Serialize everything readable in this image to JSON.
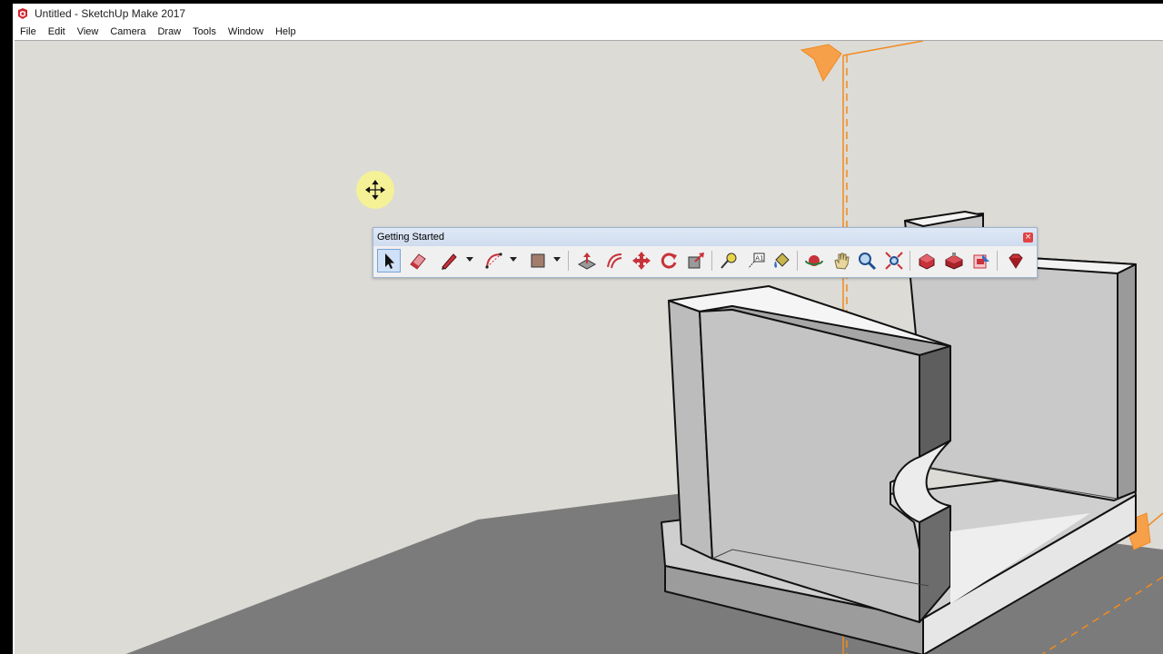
{
  "window": {
    "title": "Untitled - SketchUp Make 2017"
  },
  "menu": [
    "File",
    "Edit",
    "View",
    "Camera",
    "Draw",
    "Tools",
    "Window",
    "Help"
  ],
  "toolbar": {
    "title": "Getting Started",
    "close_glyph": "×",
    "tools": [
      {
        "name": "select-tool-button",
        "icon": "arrow-cursor-icon"
      },
      {
        "name": "eraser-tool-button",
        "icon": "eraser-icon"
      },
      {
        "name": "line-tool-button",
        "icon": "pencil-icon",
        "dropdown": true
      },
      {
        "name": "arc-tool-button",
        "icon": "arc-icon",
        "dropdown": true
      },
      {
        "name": "rectangle-tool-button",
        "icon": "rectangle-icon",
        "dropdown": true
      },
      {
        "name": "push-pull-tool-button",
        "icon": "push-pull-icon"
      },
      {
        "name": "offset-tool-button",
        "icon": "offset-icon"
      },
      {
        "name": "move-tool-button",
        "icon": "move-icon"
      },
      {
        "name": "rotate-tool-button",
        "icon": "rotate-icon"
      },
      {
        "name": "scale-tool-button",
        "icon": "scale-icon"
      },
      {
        "name": "tape-measure-tool-button",
        "icon": "tape-measure-icon"
      },
      {
        "name": "text-tool-button",
        "icon": "text-a1-icon"
      },
      {
        "name": "paint-bucket-tool-button",
        "icon": "paint-bucket-icon"
      },
      {
        "name": "orbit-tool-button",
        "icon": "orbit-icon"
      },
      {
        "name": "pan-tool-button",
        "icon": "hand-icon"
      },
      {
        "name": "zoom-tool-button",
        "icon": "magnifier-icon"
      },
      {
        "name": "zoom-extents-tool-button",
        "icon": "zoom-extents-icon"
      },
      {
        "name": "3d-warehouse-button",
        "icon": "warehouse-icon"
      },
      {
        "name": "extension-warehouse-button",
        "icon": "extension-warehouse-icon"
      },
      {
        "name": "send-to-layout-button",
        "icon": "layout-icon"
      },
      {
        "name": "extension-manager-button",
        "icon": "ruby-gem-icon"
      }
    ]
  },
  "colors": {
    "sky": "#dcdbd6",
    "ground": "#7b7b7b",
    "model_face": "#e8e8e8",
    "model_shade": "#b5b5b5",
    "section_plane": "#f28a1e",
    "toolbar_red": "#c8323a"
  }
}
